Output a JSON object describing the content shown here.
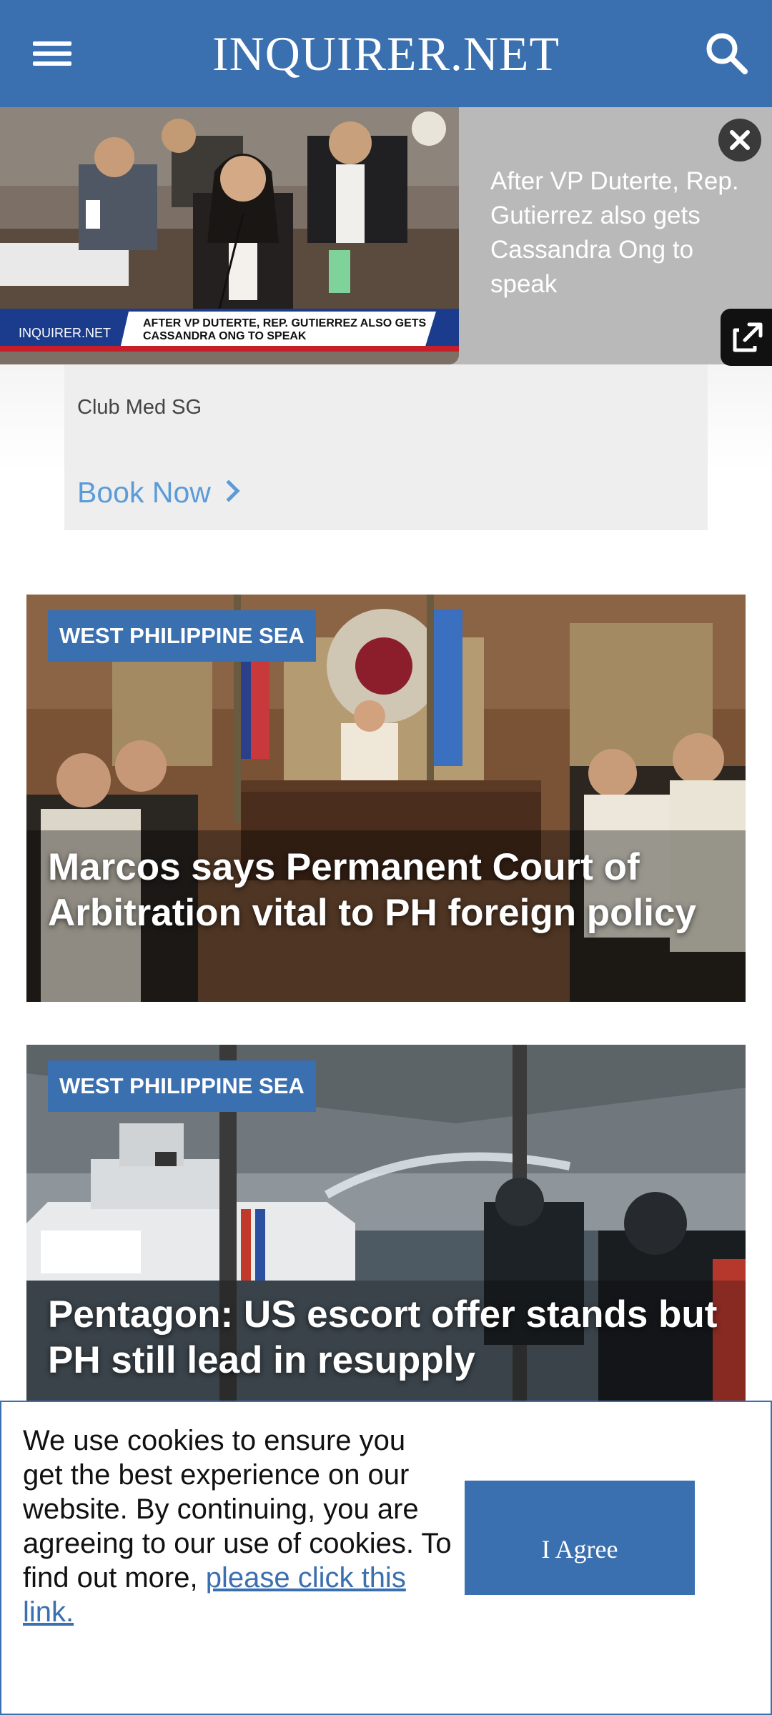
{
  "header": {
    "logo": "INQUIRER.NET",
    "menu_icon": "hamburger-menu-icon",
    "search_icon": "search-icon",
    "color": "#3a6fb0"
  },
  "ad": {
    "advertiser": "Club Med SG",
    "cta_label": "Book Now"
  },
  "video": {
    "title": "After VP Duterte, Rep. Gutierrez also gets Cassandra Ong to speak",
    "lower_third_brand": "INQUIRER.NET",
    "lower_third_text": "AFTER VP DUTERTE, REP. GUTIERREZ ALSO GETS CASSANDRA ONG TO SPEAK",
    "close_icon": "close-icon",
    "popout_icon": "external-link-icon"
  },
  "articles": [
    {
      "tag": "WEST PHILIPPINE SEA",
      "title": "Marcos says Permanent Court of Arbitration vital to PH foreign policy"
    },
    {
      "tag": "WEST PHILIPPINE SEA",
      "title": "Pentagon: US escort offer stands but PH still lead in resupply"
    }
  ],
  "cookie": {
    "text": "We use cookies to ensure you get the best experience on our website. By continuing, you are agreeing to our use of cookies. To find out more,",
    "link_label": "please click this link.",
    "button_label": "I Agree"
  }
}
